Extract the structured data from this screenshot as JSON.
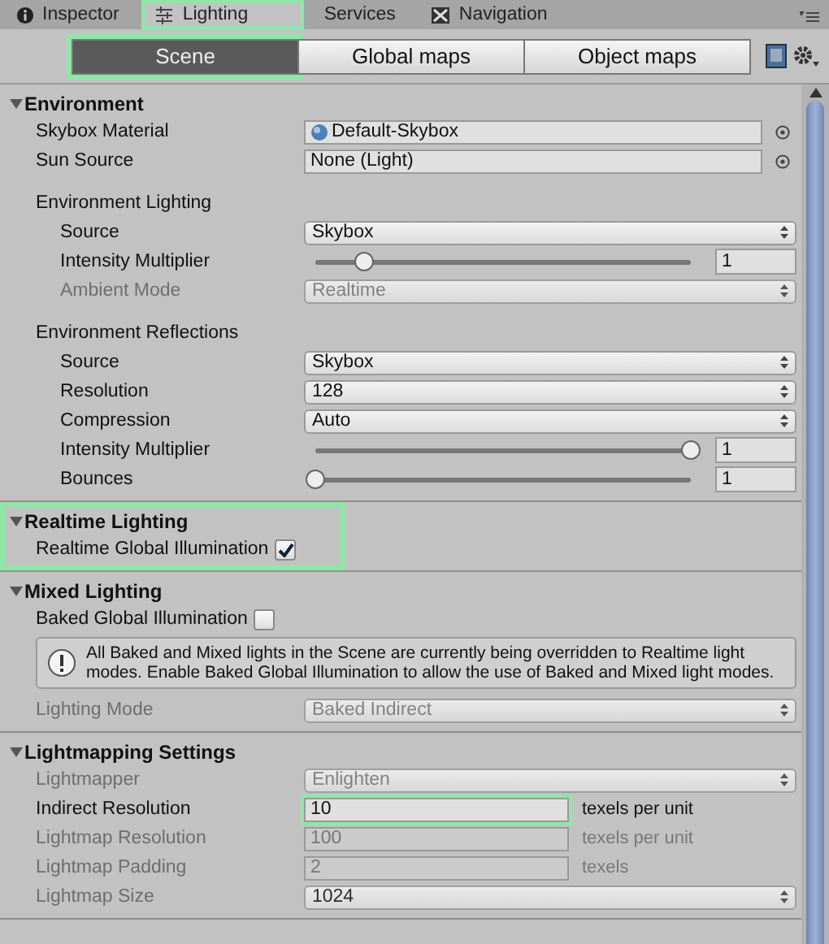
{
  "tabs": [
    {
      "label": "Inspector",
      "selected": false,
      "highlighted": false
    },
    {
      "label": "Lighting",
      "selected": true,
      "highlighted": true
    },
    {
      "label": "Services",
      "selected": false,
      "highlighted": false
    },
    {
      "label": "Navigation",
      "selected": false,
      "highlighted": false
    }
  ],
  "modes": [
    {
      "label": "Scene",
      "selected": true,
      "highlighted": true
    },
    {
      "label": "Global maps",
      "selected": false,
      "highlighted": false
    },
    {
      "label": "Object maps",
      "selected": false,
      "highlighted": false
    }
  ],
  "sections": [
    {
      "title": "Environment",
      "expanded": true,
      "highlighted": false,
      "rows": [
        {
          "kind": "object",
          "label": "Skybox Material",
          "value": "Default-Skybox",
          "asset": true
        },
        {
          "kind": "object",
          "label": "Sun Source",
          "value": "None (Light)",
          "asset": false
        },
        {
          "kind": "gap"
        },
        {
          "kind": "subheading",
          "label": "Environment Lighting",
          "children": [
            {
              "kind": "dropdown",
              "label": "Source",
              "value": "Skybox",
              "disabled": false
            },
            {
              "kind": "slider",
              "label": "Intensity Multiplier",
              "level": 0.13,
              "value": "1"
            },
            {
              "kind": "dropdown",
              "label": "Ambient Mode",
              "value": "Realtime",
              "disabled": true
            }
          ]
        },
        {
          "kind": "gap"
        },
        {
          "kind": "subheading",
          "label": "Environment Reflections",
          "children": [
            {
              "kind": "dropdown",
              "label": "Source",
              "value": "Skybox",
              "disabled": false
            },
            {
              "kind": "dropdown",
              "label": "Resolution",
              "value": "128",
              "disabled": false
            },
            {
              "kind": "dropdown",
              "label": "Compression",
              "value": "Auto",
              "disabled": false
            },
            {
              "kind": "slider",
              "label": "Intensity Multiplier",
              "level": 1,
              "value": "1"
            },
            {
              "kind": "slider",
              "label": "Bounces",
              "level": 0,
              "value": "1"
            }
          ]
        }
      ]
    },
    {
      "title": "Realtime Lighting",
      "expanded": true,
      "highlighted": true,
      "rows": [
        {
          "kind": "checkbox",
          "label": "Realtime Global Illumination",
          "checked": true
        }
      ]
    },
    {
      "title": "Mixed Lighting",
      "expanded": true,
      "highlighted": false,
      "rows": [
        {
          "kind": "checkbox",
          "label": "Baked Global Illumination",
          "checked": false
        },
        {
          "kind": "help",
          "text": "All Baked and Mixed lights in the Scene are currently being overridden to Realtime light modes. Enable Baked Global Illumination to allow the use of Baked and Mixed light modes."
        },
        {
          "kind": "dropdown",
          "label": "Lighting Mode",
          "value": "Baked Indirect",
          "disabled": true
        }
      ]
    },
    {
      "title": "Lightmapping Settings",
      "expanded": true,
      "highlighted": false,
      "rows": [
        {
          "kind": "dropdown",
          "label": "Lightmapper",
          "value": "Enlighten",
          "disabled": true
        },
        {
          "kind": "number",
          "label": "Indirect Resolution",
          "value": "10",
          "suffix": "texels per unit",
          "disabled": false,
          "highlighted": true
        },
        {
          "kind": "number",
          "label": "Lightmap Resolution",
          "value": "100",
          "suffix": "texels per unit",
          "disabled": true,
          "highlighted": false
        },
        {
          "kind": "number",
          "label": "Lightmap Padding",
          "value": "2",
          "suffix": "texels",
          "disabled": true,
          "highlighted": false
        },
        {
          "kind": "dropdown",
          "label": "Lightmap Size",
          "value": "1024",
          "disabled": true,
          "dark": true
        }
      ]
    }
  ]
}
